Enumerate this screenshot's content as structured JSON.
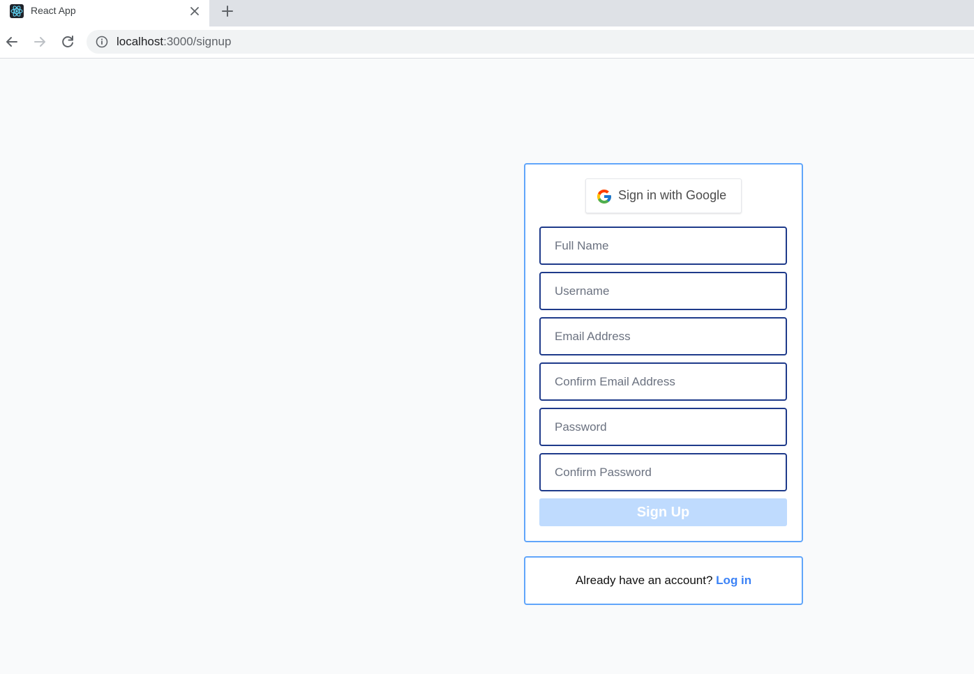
{
  "browser": {
    "tab_title": "React App",
    "url_host": "localhost",
    "url_path": ":3000/signup"
  },
  "icons": {
    "favicon": "react-logo-icon",
    "tab_close": "close-icon",
    "new_tab": "plus-icon",
    "back": "arrow-left-icon",
    "forward": "arrow-right-icon",
    "reload": "reload-icon",
    "site_info": "info-icon",
    "google": "google-logo-icon"
  },
  "colors": {
    "page_background": "#f9fafb",
    "card_border": "#60a5fa",
    "input_border": "#1e3a8a",
    "signup_button": "#bfdbfe",
    "link": "#3b82f6"
  },
  "signup": {
    "google_button_label": "Sign in with Google",
    "fields": {
      "full_name": {
        "placeholder": "Full Name",
        "value": ""
      },
      "username": {
        "placeholder": "Username",
        "value": ""
      },
      "email": {
        "placeholder": "Email Address",
        "value": ""
      },
      "confirm_email": {
        "placeholder": "Confirm Email Address",
        "value": ""
      },
      "password": {
        "placeholder": "Password",
        "value": ""
      },
      "confirm_password": {
        "placeholder": "Confirm Password",
        "value": ""
      }
    },
    "submit_label": "Sign Up"
  },
  "login": {
    "prompt": "Already have an account?",
    "link_label": "Log in"
  }
}
